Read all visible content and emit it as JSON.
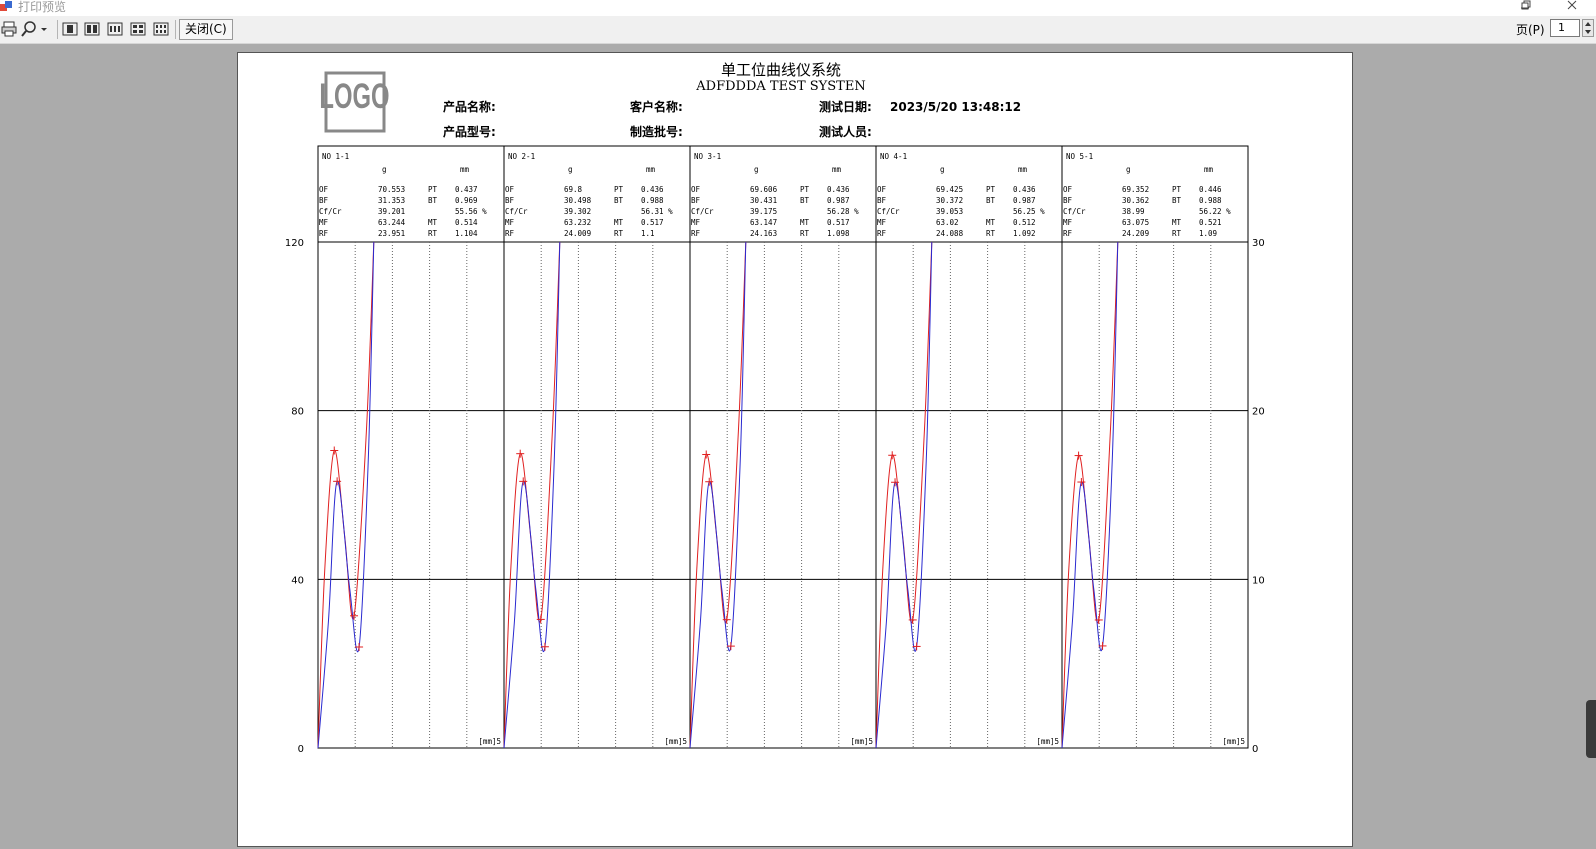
{
  "window": {
    "title": "打印预览",
    "page_label": "页(P)",
    "page_value": "1"
  },
  "toolbar": {
    "close_label": "关闭(C)"
  },
  "report": {
    "title": "单工位曲线仪系统",
    "subtitle": "ADFDDDA TEST SYSTEN",
    "logo_text": "LOGO",
    "product_name_label": "产品名称:",
    "customer_name_label": "客户名称:",
    "test_date_label": "测试日期:",
    "test_date_value": "2023/5/20 13:48:12",
    "product_model_label": "产品型号:",
    "batch_no_label": "制造批号:",
    "tester_label": "测试人员:",
    "unit_g": "g",
    "unit_mm": "mm",
    "unit_x": "[mm]5",
    "stations": [
      {
        "no": "NO 1-1",
        "OF": "70.553",
        "PT": "0.437",
        "BF": "31.353",
        "BT": "0.969",
        "CfCr": "39.201",
        "pct": "55.56 %",
        "MF": "63.244",
        "MT": "0.514",
        "RF": "23.951",
        "RT": "1.104"
      },
      {
        "no": "NO 2-1",
        "OF": "69.8",
        "PT": "0.436",
        "BF": "30.498",
        "BT": "0.988",
        "CfCr": "39.302",
        "pct": "56.31 %",
        "MF": "63.232",
        "MT": "0.517",
        "RF": "24.009",
        "RT": "1.1"
      },
      {
        "no": "NO 3-1",
        "OF": "69.606",
        "PT": "0.436",
        "BF": "30.431",
        "BT": "0.987",
        "CfCr": "39.175",
        "pct": "56.28 %",
        "MF": "63.147",
        "MT": "0.517",
        "RF": "24.163",
        "RT": "1.098"
      },
      {
        "no": "NO 4-1",
        "OF": "69.425",
        "PT": "0.436",
        "BF": "30.372",
        "BT": "0.987",
        "CfCr": "39.053",
        "pct": "56.25 %",
        "MF": "63.02",
        "MT": "0.512",
        "RF": "24.088",
        "RT": "1.092"
      },
      {
        "no": "NO 5-1",
        "OF": "69.352",
        "PT": "0.446",
        "BF": "30.362",
        "BT": "0.988",
        "CfCr": "38.99",
        "pct": "56.22 %",
        "MF": "63.075",
        "MT": "0.521",
        "RF": "24.209",
        "RT": "1.09"
      }
    ],
    "param_labels": {
      "OF": "OF",
      "PT": "PT",
      "BF": "BF",
      "BT": "BT",
      "CfCr": "Cf/Cr",
      "MF": "MF",
      "MT": "MT",
      "RF": "RF",
      "RT": "RT"
    },
    "left_axis_ticks": [
      "0",
      "40",
      "80",
      "120"
    ],
    "right_axis_ticks": [
      "0",
      "10",
      "20",
      "30"
    ],
    "colors": {
      "press_curve": "#e02020",
      "release_curve": "#2a2ad0"
    }
  },
  "chart_data": {
    "type": "line",
    "panels": 5,
    "x_range": [
      0,
      5
    ],
    "y_left_range": [
      0,
      120
    ],
    "y_right_range": [
      0,
      30
    ],
    "series_per_panel": [
      {
        "points": [
          [
            0,
            0
          ],
          [
            0.437,
            70.5
          ],
          [
            0.969,
            31.4
          ],
          [
            1.104,
            24.0
          ],
          [
            1.5,
            120
          ]
        ]
      },
      {
        "points": [
          [
            0,
            0
          ],
          [
            0.514,
            63.2
          ],
          [
            1.104,
            24.0
          ],
          [
            1.5,
            120
          ]
        ]
      }
    ]
  }
}
